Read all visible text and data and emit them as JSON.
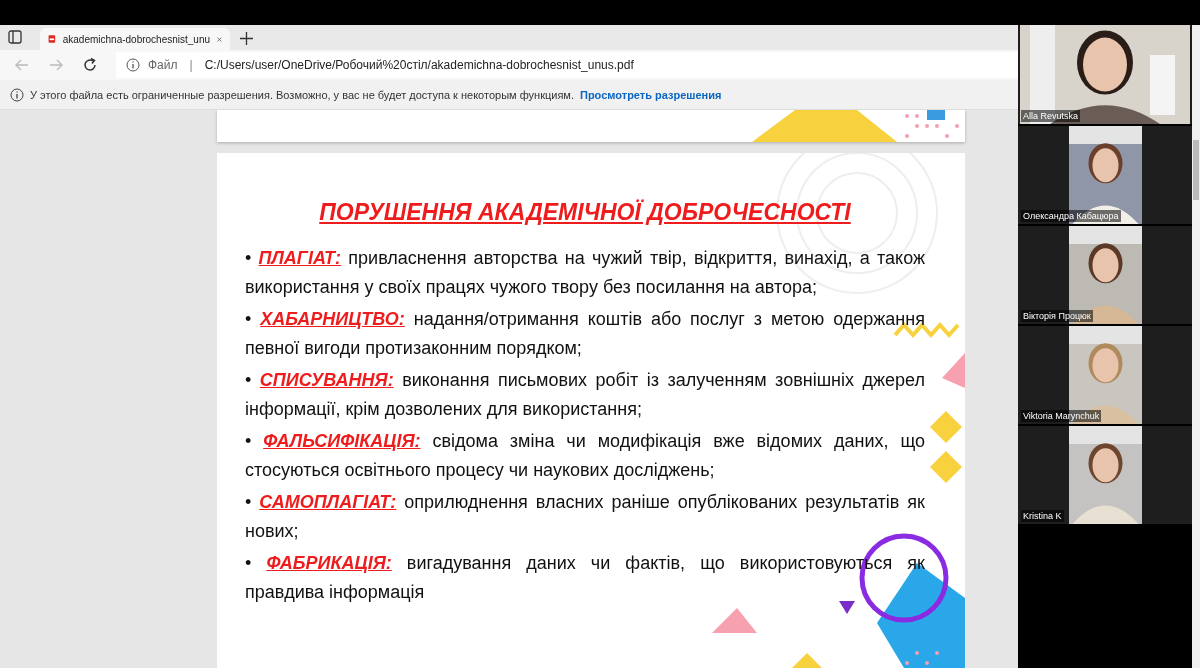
{
  "tab": {
    "title": "akademichna-dobrochesnist_unu",
    "selected": true
  },
  "address": {
    "scheme": "Файл",
    "separator": "|",
    "url": "C:/Users/user/OneDrive/Робочий%20стіл/akademichna-dobrochesnist_unus.pdf"
  },
  "info_bar": {
    "message": "У этого файла есть ограниченные разрешения. Возможно, у вас не будет доступа к некоторым функциям.",
    "link": "Просмотреть разрешения"
  },
  "slide": {
    "title": "ПОРУШЕННЯ АКАДЕМІЧНОЇ ДОБРОЧЕСНОСТІ",
    "items": [
      "• **ПЛАГІАТ:** привласнення авторства на чужий твір, відкриття, винахід, а також використання у своїх працях чужого твору без посилання на автора;",
      "• **ХАБАРНИЦТВО:** надання/отримання коштів або послуг з метою одержання певної вигоди протизаконним порядком;",
      "• **СПИСУВАННЯ:** виконання письмових робіт із залученням зовнішніх джерел інформації, крім дозволених для використання;",
      "• **ФАЛЬСИФІКАЦІЯ:** свідома зміна чи модифікація вже відомих даних, що стосуються освітнього процесу чи наукових досліджень;",
      "• **САМОПЛАГІАТ:** оприлюднення власних раніше опублікованих результатів як нових;",
      "• **ФАБРИКАЦІЯ:** вигадування даних чи фактів, що використовуються як правдива інформація"
    ]
  },
  "participants": [
    {
      "name": "Alla Revutska",
      "kind": "speaker"
    },
    {
      "name": "Олександра Кабацюра",
      "kind": "tile"
    },
    {
      "name": "Вікторія Процюк",
      "kind": "tile"
    },
    {
      "name": "Viktoria Marynchuk",
      "kind": "tile"
    },
    {
      "name": "Kristina K",
      "kind": "tile"
    }
  ]
}
